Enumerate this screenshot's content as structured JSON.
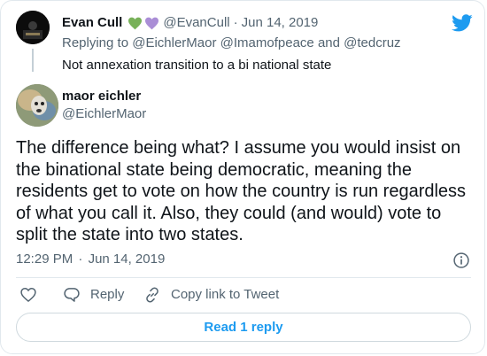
{
  "parent_tweet": {
    "author_name": "Evan Cull",
    "emoji_icons": [
      "green-heart-icon",
      "purple-heart-icon"
    ],
    "handle": "@EvanCull",
    "separator": "·",
    "date": "Jun 14, 2019",
    "replying_to_prefix": "Replying to",
    "replying_to": [
      "@EichlerMaor",
      "@Imamofpeace",
      "@tedcruz"
    ],
    "replying_to_joiner": "and",
    "text": "Not annexation transition to a bi national state"
  },
  "main_tweet": {
    "author_name": "maor eichler",
    "handle": "@EichlerMaor",
    "text": "The difference being what? I assume you would insist on the binational state being democratic, meaning the residents get to vote on how the country is run regardless of what you call it. Also, they could (and would) vote to split the state into two states.",
    "time": "12:29 PM",
    "separator": "·",
    "date": "Jun 14, 2019"
  },
  "actions": {
    "reply_label": "Reply",
    "copy_link_label": "Copy link to Tweet",
    "read_replies_label": "Read 1 reply"
  },
  "colors": {
    "brand_blue": "#1d9bf0",
    "green_heart": "#78b159",
    "purple_heart": "#aa8ed6",
    "muted_text": "#536471",
    "border": "#e1e8ed"
  },
  "icons": [
    "twitter-bird-icon",
    "info-icon",
    "heart-icon",
    "reply-icon",
    "link-icon"
  ]
}
